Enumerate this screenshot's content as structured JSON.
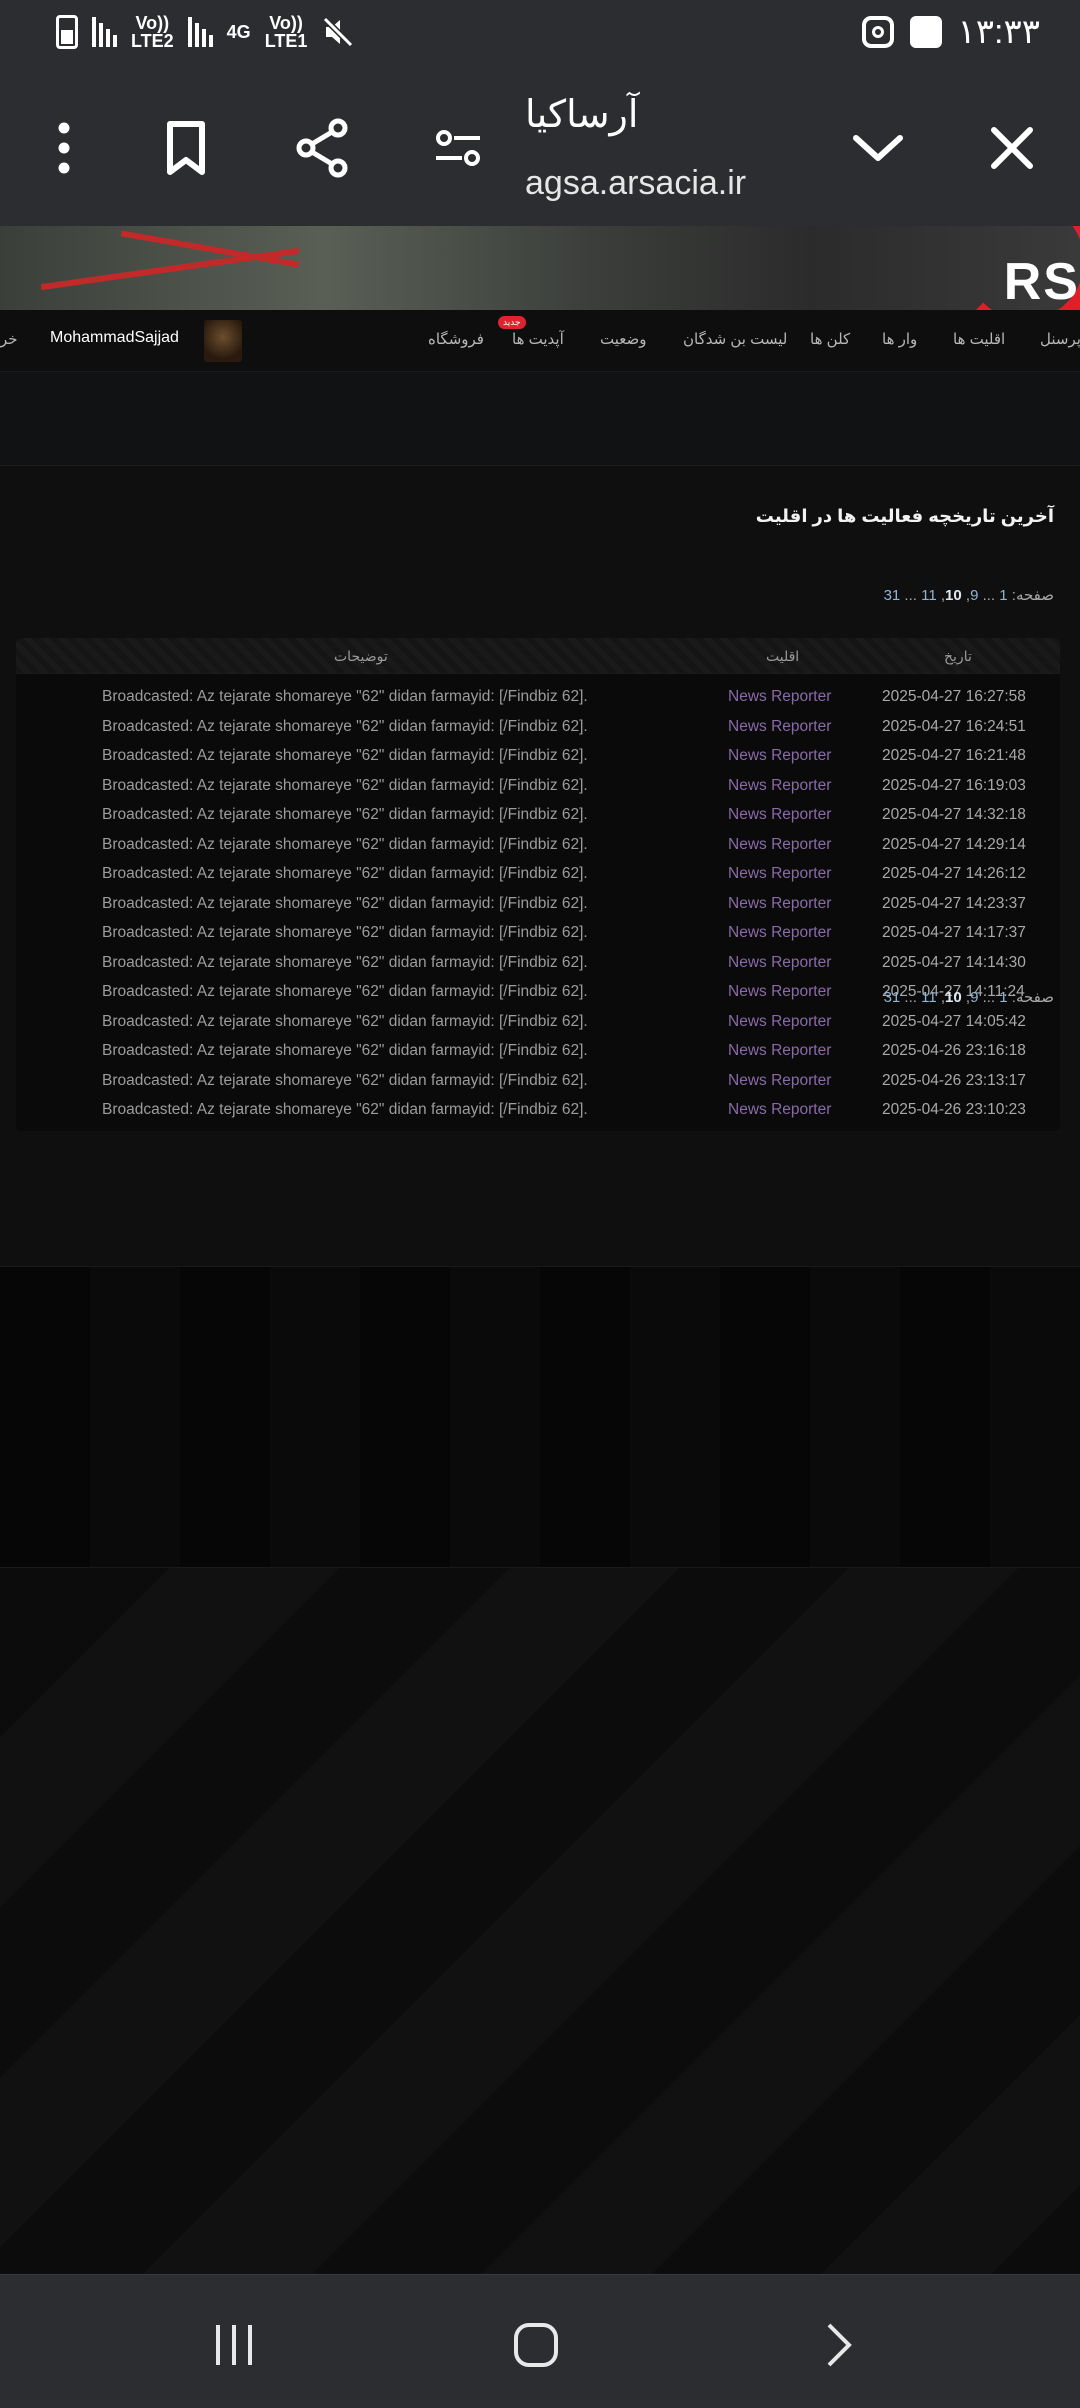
{
  "status_bar": {
    "network_1": "Vo))\nLTE2",
    "network_gen": "4G",
    "network_2": "Vo))\nLTE1",
    "time": "۱۳:۳۳"
  },
  "browser": {
    "title": "آرساکیا",
    "url": "agsa.arsacia.ir"
  },
  "banner": {
    "logo_text": "RS"
  },
  "nav": {
    "items": [
      "پرسنل",
      "اقلیت ها",
      "وار ها",
      "کلن ها",
      "لیست بن شدگان",
      "وضعیت",
      "آپدیت ها",
      "فروشگاه"
    ],
    "badge": "جدید",
    "username": "MohammadSajjad",
    "cut_item": "خر"
  },
  "main": {
    "heading": "آخرین تاریخچه فعالیت ها در اقلیت",
    "pager": {
      "label": "صفحه:",
      "first": "1",
      "gap": "...",
      "pages": [
        "9",
        "10",
        "11"
      ],
      "current": "10",
      "last": "31"
    },
    "table": {
      "columns": {
        "date": "تاریخ",
        "minority": "اقلیت",
        "desc": "توضیحات"
      },
      "rows": [
        {
          "date": "2025-04-27 16:27:58",
          "minority": "News Reporter",
          "desc": "Broadcasted: Az tejarate shomareye \"62\" didan farmayid: [/Findbiz 62]."
        },
        {
          "date": "2025-04-27 16:24:51",
          "minority": "News Reporter",
          "desc": "Broadcasted: Az tejarate shomareye \"62\" didan farmayid: [/Findbiz 62]."
        },
        {
          "date": "2025-04-27 16:21:48",
          "minority": "News Reporter",
          "desc": "Broadcasted: Az tejarate shomareye \"62\" didan farmayid: [/Findbiz 62]."
        },
        {
          "date": "2025-04-27 16:19:03",
          "minority": "News Reporter",
          "desc": "Broadcasted: Az tejarate shomareye \"62\" didan farmayid: [/Findbiz 62]."
        },
        {
          "date": "2025-04-27 14:32:18",
          "minority": "News Reporter",
          "desc": "Broadcasted: Az tejarate shomareye \"62\" didan farmayid: [/Findbiz 62]."
        },
        {
          "date": "2025-04-27 14:29:14",
          "minority": "News Reporter",
          "desc": "Broadcasted: Az tejarate shomareye \"62\" didan farmayid: [/Findbiz 62]."
        },
        {
          "date": "2025-04-27 14:26:12",
          "minority": "News Reporter",
          "desc": "Broadcasted: Az tejarate shomareye \"62\" didan farmayid: [/Findbiz 62]."
        },
        {
          "date": "2025-04-27 14:23:37",
          "minority": "News Reporter",
          "desc": "Broadcasted: Az tejarate shomareye \"62\" didan farmayid: [/Findbiz 62]."
        },
        {
          "date": "2025-04-27 14:17:37",
          "minority": "News Reporter",
          "desc": "Broadcasted: Az tejarate shomareye \"62\" didan farmayid: [/Findbiz 62]."
        },
        {
          "date": "2025-04-27 14:14:30",
          "minority": "News Reporter",
          "desc": "Broadcasted: Az tejarate shomareye \"62\" didan farmayid: [/Findbiz 62]."
        },
        {
          "date": "2025-04-27 14:11:24",
          "minority": "News Reporter",
          "desc": "Broadcasted: Az tejarate shomareye \"62\" didan farmayid: [/Findbiz 62]."
        },
        {
          "date": "2025-04-27 14:05:42",
          "minority": "News Reporter",
          "desc": "Broadcasted: Az tejarate shomareye \"62\" didan farmayid: [/Findbiz 62]."
        },
        {
          "date": "2025-04-26 23:16:18",
          "minority": "News Reporter",
          "desc": "Broadcasted: Az tejarate shomareye \"62\" didan farmayid: [/Findbiz 62]."
        },
        {
          "date": "2025-04-26 23:13:17",
          "minority": "News Reporter",
          "desc": "Broadcasted: Az tejarate shomareye \"62\" didan farmayid: [/Findbiz 62]."
        },
        {
          "date": "2025-04-26 23:10:23",
          "minority": "News Reporter",
          "desc": "Broadcasted: Az tejarate shomareye \"62\" didan farmayid: [/Findbiz 62]."
        }
      ]
    }
  },
  "colors": {
    "accent_red": "#e0242f",
    "minority_link": "#8a6aa8",
    "pager_link": "#8fb4d4"
  }
}
